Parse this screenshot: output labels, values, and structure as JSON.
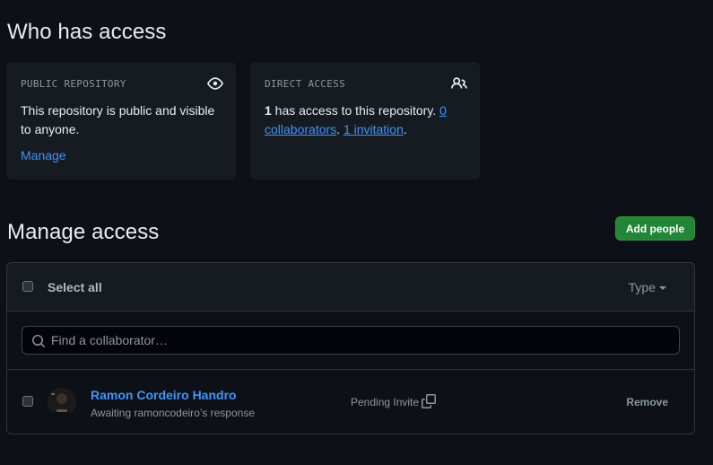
{
  "who_has_access": {
    "title": "Who has access",
    "public_card": {
      "label": "PUBLIC REPOSITORY",
      "icon": "eye-icon",
      "text": "This repository is public and visible to anyone.",
      "link": "Manage"
    },
    "direct_card": {
      "label": "DIRECT ACCESS",
      "icon": "people-icon",
      "count": "1",
      "text_mid": " has access to this repository. ",
      "collaborators_link": "0 collaborators",
      "sep": ". ",
      "invitations_link": "1 invitation",
      "end": "."
    }
  },
  "manage_access": {
    "title": "Manage access",
    "add_button": "Add people",
    "select_all": "Select all",
    "type_filter": "Type",
    "search": {
      "placeholder": "Find a collaborator…",
      "value": ""
    },
    "members": [
      {
        "name": "Ramon Cordeiro Handro",
        "subtitle": "Awaiting ramoncodeiro’s response",
        "status": "Pending Invite",
        "action": "Remove"
      }
    ]
  },
  "colors": {
    "background": "#0d1117",
    "card": "#161b22",
    "border": "#30363d",
    "link": "#4493f8",
    "primary_button": "#238636",
    "muted_text": "#8d96a0"
  }
}
